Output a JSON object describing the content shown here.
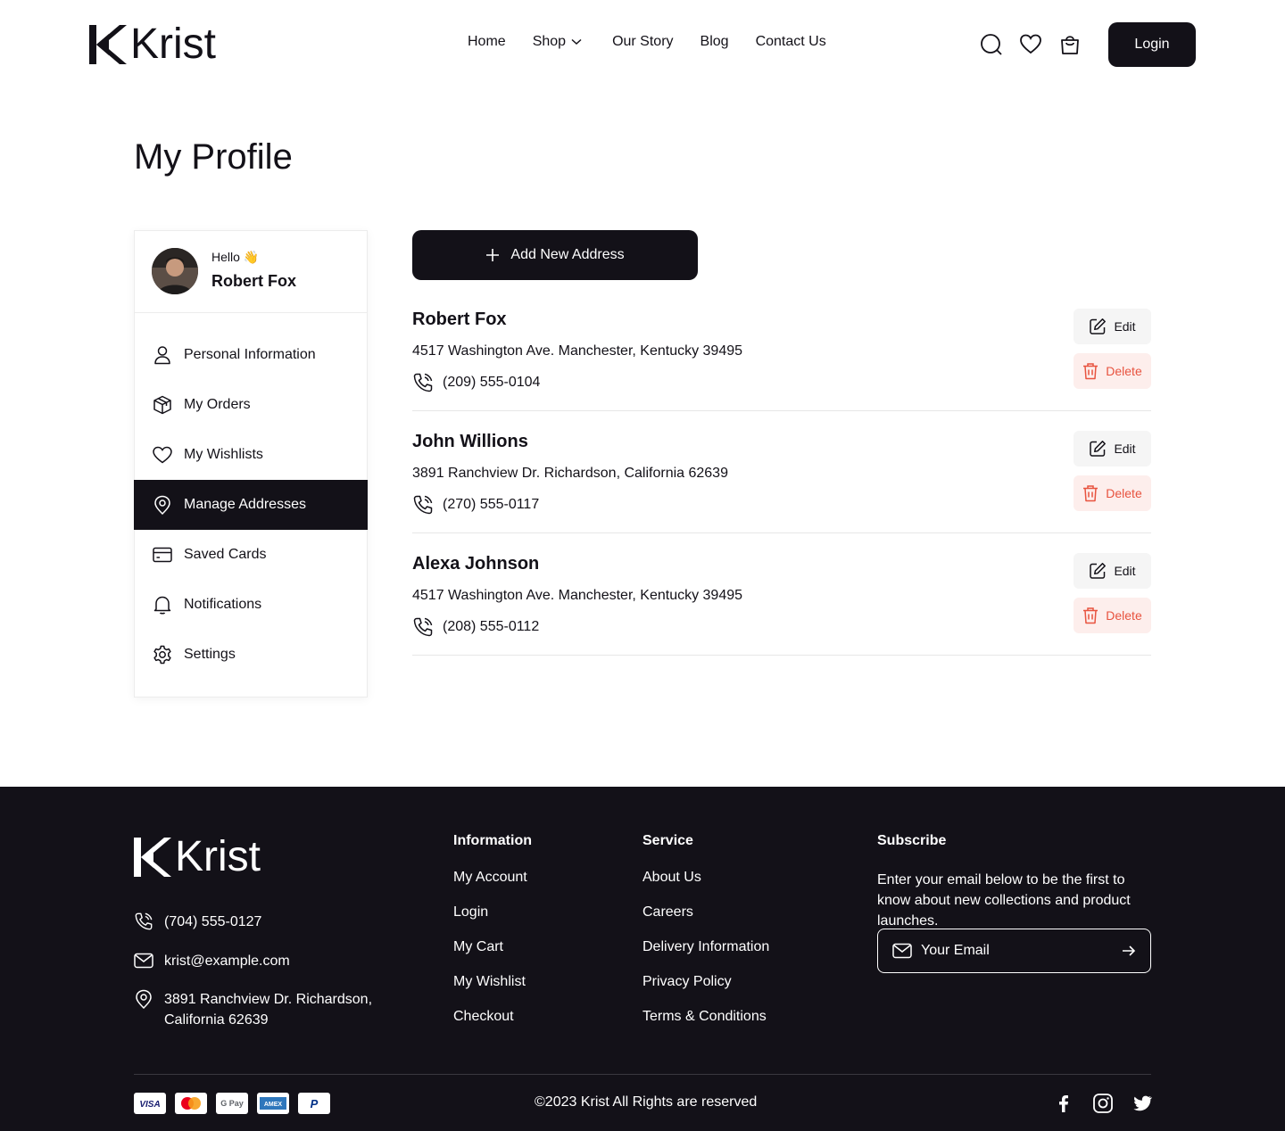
{
  "header": {
    "logo_text": "Krist",
    "nav": {
      "home": "Home",
      "shop": "Shop",
      "our_story": "Our Story",
      "blog": "Blog",
      "contact": "Contact Us"
    },
    "login_label": "Login",
    "icons": [
      "search-icon",
      "heart-icon",
      "bag-icon"
    ]
  },
  "page": {
    "title": "My Profile"
  },
  "sidebar": {
    "greeting": "Hello 👋",
    "user_name": "Robert Fox",
    "items": [
      {
        "label": "Personal Information",
        "icon": "user-icon",
        "active": false
      },
      {
        "label": "My Orders",
        "icon": "box-icon",
        "active": false
      },
      {
        "label": "My Wishlists",
        "icon": "heart-icon",
        "active": false
      },
      {
        "label": "Manage Addresses",
        "icon": "location-icon",
        "active": true
      },
      {
        "label": "Saved Cards",
        "icon": "card-icon",
        "active": false
      },
      {
        "label": "Notifications",
        "icon": "bell-icon",
        "active": false
      },
      {
        "label": "Settings",
        "icon": "gear-icon",
        "active": false
      }
    ]
  },
  "addresses": {
    "add_label": "Add New Address",
    "edit_label": "Edit",
    "delete_label": "Delete",
    "list": [
      {
        "name": "Robert Fox",
        "address": "4517 Washington Ave. Manchester, Kentucky 39495",
        "phone": "(209) 555-0104"
      },
      {
        "name": "John Willions",
        "address": "3891 Ranchview Dr. Richardson, California 62639",
        "phone": "(270) 555-0117"
      },
      {
        "name": "Alexa Johnson",
        "address": "4517 Washington Ave. Manchester, Kentucky 39495",
        "phone": "(208) 555-0112"
      }
    ]
  },
  "footer": {
    "logo_text": "Krist",
    "phone": "(704) 555-0127",
    "email": "krist@example.com",
    "address_line1": "3891 Ranchview Dr. Richardson,",
    "address_line2": "California 62639",
    "information": {
      "title": "Information",
      "links": [
        "My Account",
        "Login",
        "My Cart",
        "My Wishlist",
        "Checkout"
      ]
    },
    "service": {
      "title": "Service",
      "links": [
        "About Us",
        "Careers",
        "Delivery Information",
        "Privacy Policy",
        "Terms & Conditions"
      ]
    },
    "subscribe": {
      "title": "Subscribe",
      "text": "Enter your email below to be the first to know about new collections and product launches.",
      "placeholder": "Your Email"
    },
    "payments": [
      "VISA",
      "mastercard",
      "G Pay",
      "AMEX",
      "PayPal"
    ],
    "copyright": "©2023 Krist All Rights are reserved",
    "socials": [
      "facebook-icon",
      "instagram-icon",
      "twitter-icon"
    ]
  },
  "colors": {
    "primary": "#131118",
    "delete_text": "#e8533f",
    "delete_bg": "#fdeeec",
    "edit_bg": "#f5f5f5"
  }
}
